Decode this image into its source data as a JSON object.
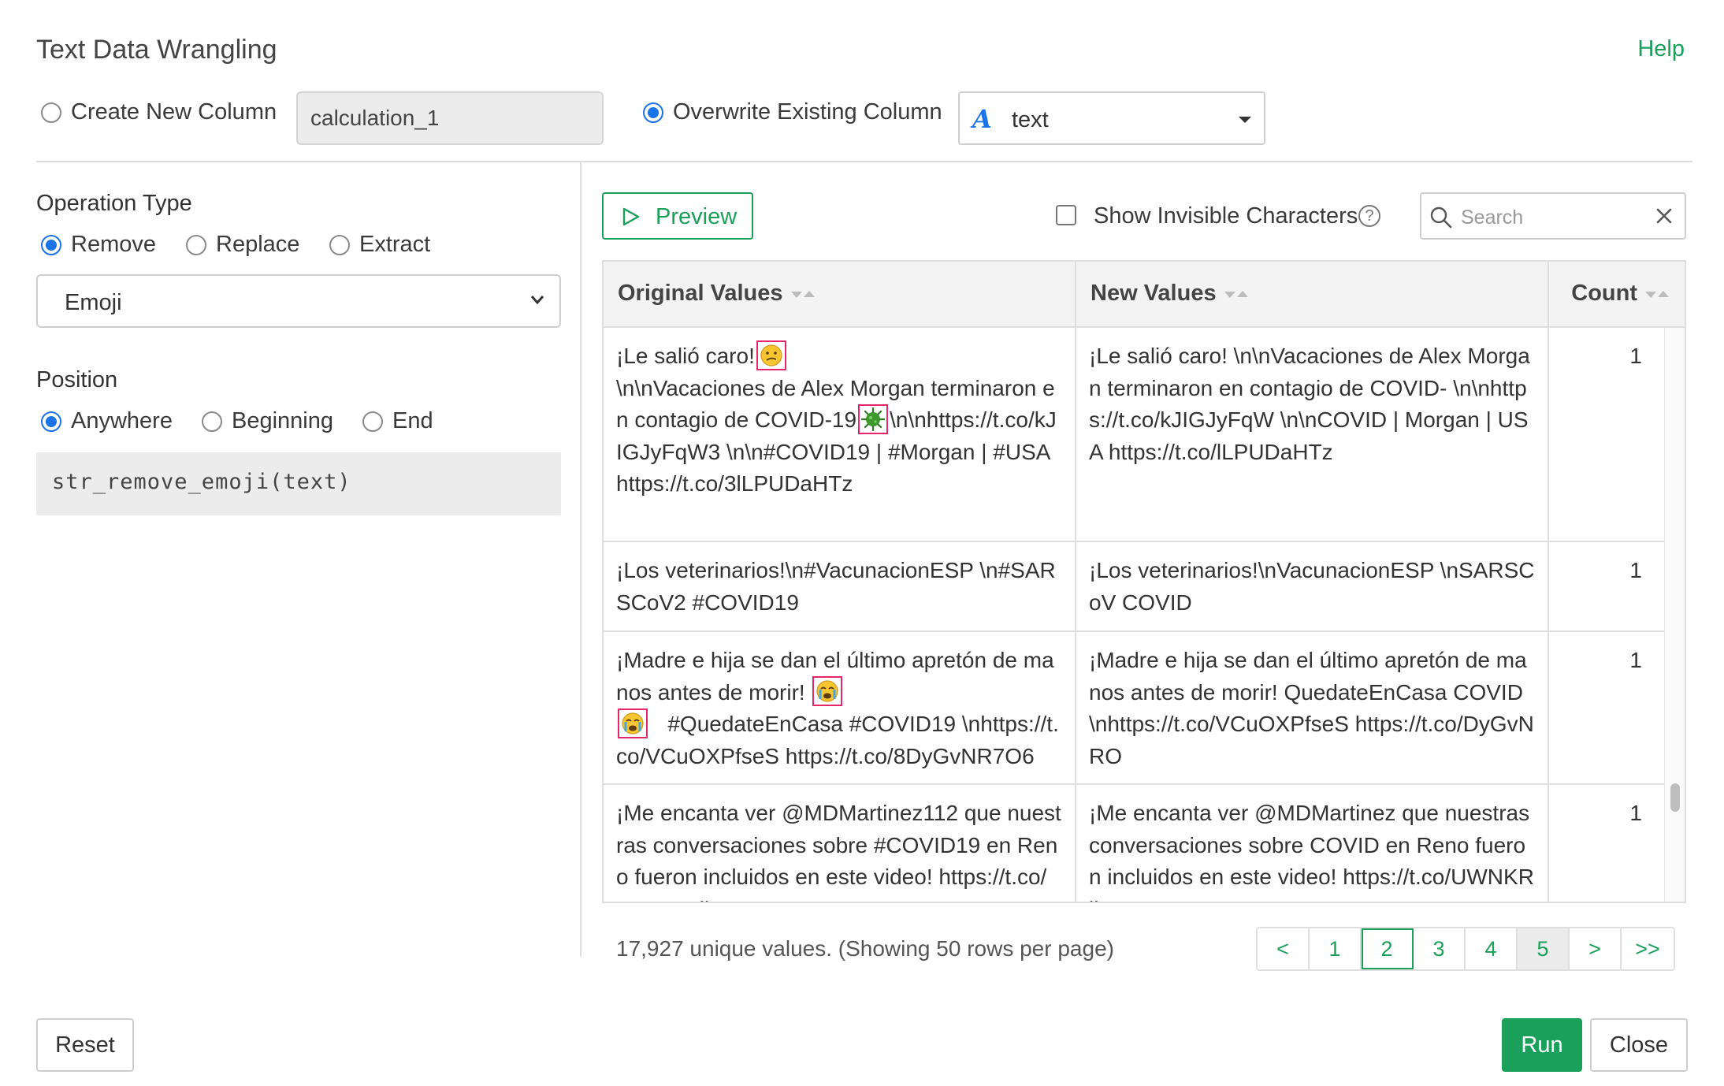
{
  "dialog": {
    "title": "Text Data Wrangling",
    "help_label": "Help"
  },
  "output": {
    "create_new_label": "Create New Column",
    "new_column_name": "calculation_1",
    "overwrite_label": "Overwrite Existing Column",
    "overwrite_selected": true,
    "column_type_glyph": "A",
    "column_value": "text"
  },
  "operation": {
    "label": "Operation Type",
    "options": [
      "Remove",
      "Replace",
      "Extract"
    ],
    "selected": "Remove",
    "target_value": "Emoji"
  },
  "position": {
    "label": "Position",
    "options": [
      "Anywhere",
      "Beginning",
      "End"
    ],
    "selected": "Anywhere"
  },
  "code": "str_remove_emoji(text)",
  "toolbar": {
    "preview_label": "Preview",
    "show_invisible_label": "Show Invisible Characters",
    "show_invisible_checked": false,
    "search_placeholder": "Search"
  },
  "table": {
    "columns": [
      "Original Values",
      "New Values",
      "Count"
    ],
    "rows": [
      {
        "orig": [
          "¡Le salió caro!",
          "\\n\\nVacaciones de Alex Morgan terminaron en contagio de COVID-19",
          "\\n\\nhttps://t.co/kJIGJyFqW3 \\n\\n#COVID19 | #Morgan | #USA https://t.co/3lLPUDaHTz"
        ],
        "emojis": [
          "confused-face",
          "virus"
        ],
        "new": "¡Le salió caro! \\n\\nVacaciones de Alex Morgan terminaron en contagio de COVID-  \\n\\nhttps://t.co/kJIGJyFqW \\n\\nCOVID | Morgan | USA https://t.co/lLPUDaHTz",
        "count": "1"
      },
      {
        "orig": [
          "¡Los veterinarios!\\n#VacunacionESP \\n#SARSCoV2  #COVID19"
        ],
        "emojis": [],
        "new": "¡Los veterinarios!\\nVacunacionESP \\nSARSCoV  COVID",
        "count": "1"
      },
      {
        "orig": [
          "¡Madre e hija se dan el último apretón de manos antes de morir!",
          "#QuedateEnCasa #COVID19 \\nhttps://t.co/VCuOXPfseS https://t.co/8DyGvNR7O6"
        ],
        "emojis": [
          "crying-face",
          "crying-face"
        ],
        "new": "¡Madre e hija se dan el último apretón de manos antes de morir!    QuedateEnCasa COVID \\nhttps://t.co/VCuOXPfseS https://t.co/DyGvNRO",
        "count": "1"
      },
      {
        "orig": [
          "¡Me encanta ver @MDMartinez112 que nuestras conversaciones sobre #COVID19 en Reno fueron incluidos en este video! https://t.co/UWNKRlk"
        ],
        "emojis": [],
        "new": "¡Me encanta ver @MDMartinez que nuestras conversaciones sobre COVID en Reno fueron incluidos en este video! https://t.co/UWNKRlk",
        "count": "1"
      }
    ]
  },
  "footer": {
    "summary": "17,927 unique values. (Showing 50 rows per page)",
    "pages": [
      "<",
      "1",
      "2",
      "3",
      "4",
      "5",
      ">",
      ">>"
    ],
    "current_page": "2",
    "reset_label": "Reset",
    "run_label": "Run",
    "close_label": "Close"
  },
  "colors": {
    "accent": "#1aa05a",
    "radio": "#1a73e8",
    "emoji_highlight": "#e5266a"
  }
}
